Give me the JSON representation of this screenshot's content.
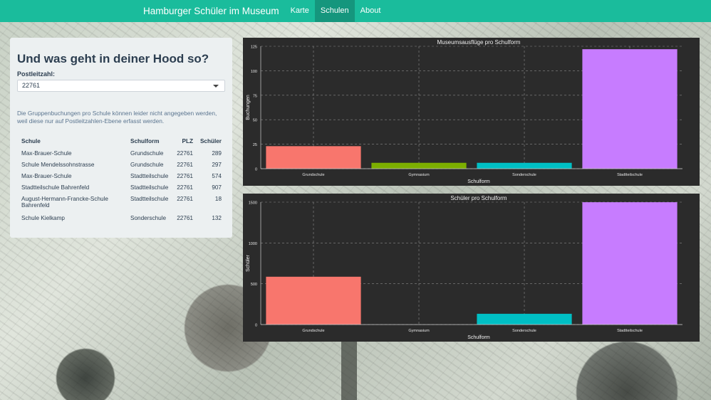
{
  "navbar": {
    "brand": "Hamburger Schüler im Museum",
    "items": [
      {
        "label": "Karte",
        "active": false
      },
      {
        "label": "Schulen",
        "active": true
      },
      {
        "label": "About",
        "active": false
      }
    ],
    "color": "#1abc9c"
  },
  "sidebar": {
    "title": "Und was geht in deiner Hood so?",
    "postcode_label": "Postleitzahl:",
    "postcode_value": "22761",
    "note": "Die Gruppenbuchungen pro Schule können leider nicht angegeben werden, weil diese nur auf Postleitzahlen-Ebene erfasst werden.",
    "table": {
      "headers": [
        "Schule",
        "Schulform",
        "PLZ",
        "Schüler"
      ],
      "rows": [
        [
          "Max-Brauer-Schule",
          "Grundschule",
          "22761",
          "289"
        ],
        [
          "Schule Mendelssohnstrasse",
          "Grundschule",
          "22761",
          "297"
        ],
        [
          "Max-Brauer-Schule",
          "Stadtteilschule",
          "22761",
          "574"
        ],
        [
          "Stadtteilschule Bahrenfeld",
          "Stadtteilschule",
          "22761",
          "907"
        ],
        [
          "August-Hermann-Francke-Schule Bahrenfeld",
          "Stadtteilschule",
          "22761",
          "18"
        ],
        [
          "Schule Kielkamp",
          "Sonderschule",
          "22761",
          "132"
        ]
      ]
    }
  },
  "chart_data": [
    {
      "type": "bar",
      "title": "Museumsausflüge pro Schulform",
      "xlabel": "Schulform",
      "ylabel": "Buchungen",
      "categories": [
        "Grundschule",
        "Gymnasium",
        "Sonderschule",
        "Stadtteilschule"
      ],
      "values": [
        23,
        6,
        6,
        122
      ],
      "colors": [
        "#f8766d",
        "#7cae00",
        "#00bfc4",
        "#c77cff"
      ],
      "ylim": [
        0,
        125
      ],
      "yticks": [
        0,
        25,
        50,
        75,
        100,
        125
      ],
      "grid": true
    },
    {
      "type": "bar",
      "title": "Schüler pro Schulform",
      "xlabel": "Schulform",
      "ylabel": "Schüler",
      "categories": [
        "Grundschule",
        "Gymnasium",
        "Sonderschule",
        "Stadtteilschule"
      ],
      "values": [
        586,
        0,
        132,
        1499
      ],
      "colors": [
        "#f8766d",
        "#7cae00",
        "#00bfc4",
        "#c77cff"
      ],
      "ylim": [
        0,
        1500
      ],
      "yticks": [
        0,
        500,
        1000,
        1500
      ],
      "grid": true
    }
  ]
}
